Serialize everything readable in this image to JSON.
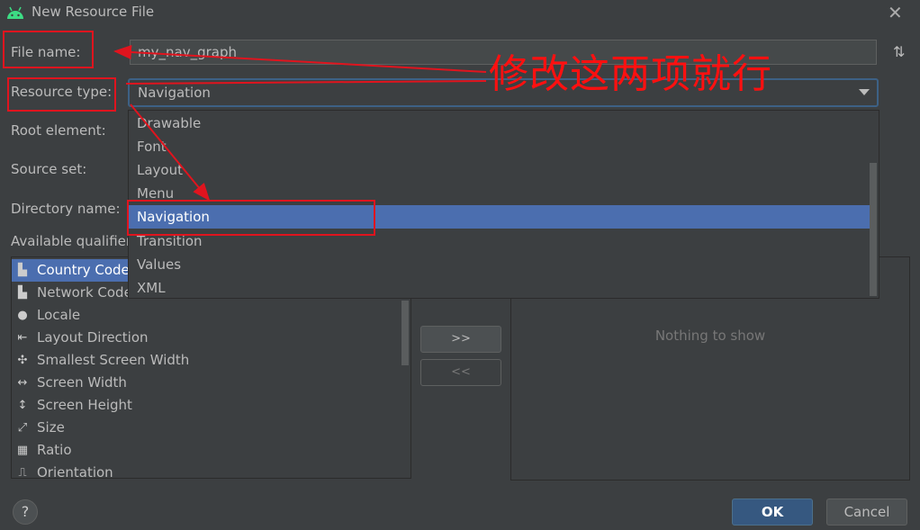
{
  "window": {
    "title": "New Resource File",
    "close_icon": "close-icon",
    "app_icon": "android-icon"
  },
  "form": {
    "file_name_label": "File name:",
    "file_name_value": "my_nav_graph",
    "resource_type_label": "Resource type:",
    "resource_type_value": "Navigation",
    "root_element_label": "Root element:",
    "source_set_label": "Source set:",
    "directory_name_label": "Directory name:",
    "available_qualifiers_label": "Available qualifier"
  },
  "dropdown": {
    "items": [
      "Drawable",
      "Font",
      "Layout",
      "Menu",
      "Navigation",
      "Transition",
      "Values",
      "XML"
    ],
    "selected": "Navigation"
  },
  "qualifiers": {
    "items": [
      {
        "label": "Country Code",
        "icon": "country-code-icon"
      },
      {
        "label": "Network Code",
        "icon": "network-code-icon"
      },
      {
        "label": "Locale",
        "icon": "globe-icon"
      },
      {
        "label": "Layout Direction",
        "icon": "layout-direction-icon"
      },
      {
        "label": "Smallest Screen Width",
        "icon": "smallest-width-icon"
      },
      {
        "label": "Screen Width",
        "icon": "screen-width-icon"
      },
      {
        "label": "Screen Height",
        "icon": "screen-height-icon"
      },
      {
        "label": "Size",
        "icon": "size-icon"
      },
      {
        "label": "Ratio",
        "icon": "ratio-icon"
      },
      {
        "label": "Orientation",
        "icon": "orientation-icon"
      }
    ],
    "selected": "Country Code"
  },
  "buttons": {
    "add": ">>",
    "remove": "<<",
    "ok": "OK",
    "cancel": "Cancel",
    "help": "?"
  },
  "chosen_panel": {
    "empty_text": "Nothing to show"
  },
  "annotation": {
    "text": "修改这两项就行",
    "color": "#e0141e"
  },
  "colors": {
    "background": "#3c3f41",
    "selection": "#4b6eaf",
    "ok_button": "#365880"
  }
}
